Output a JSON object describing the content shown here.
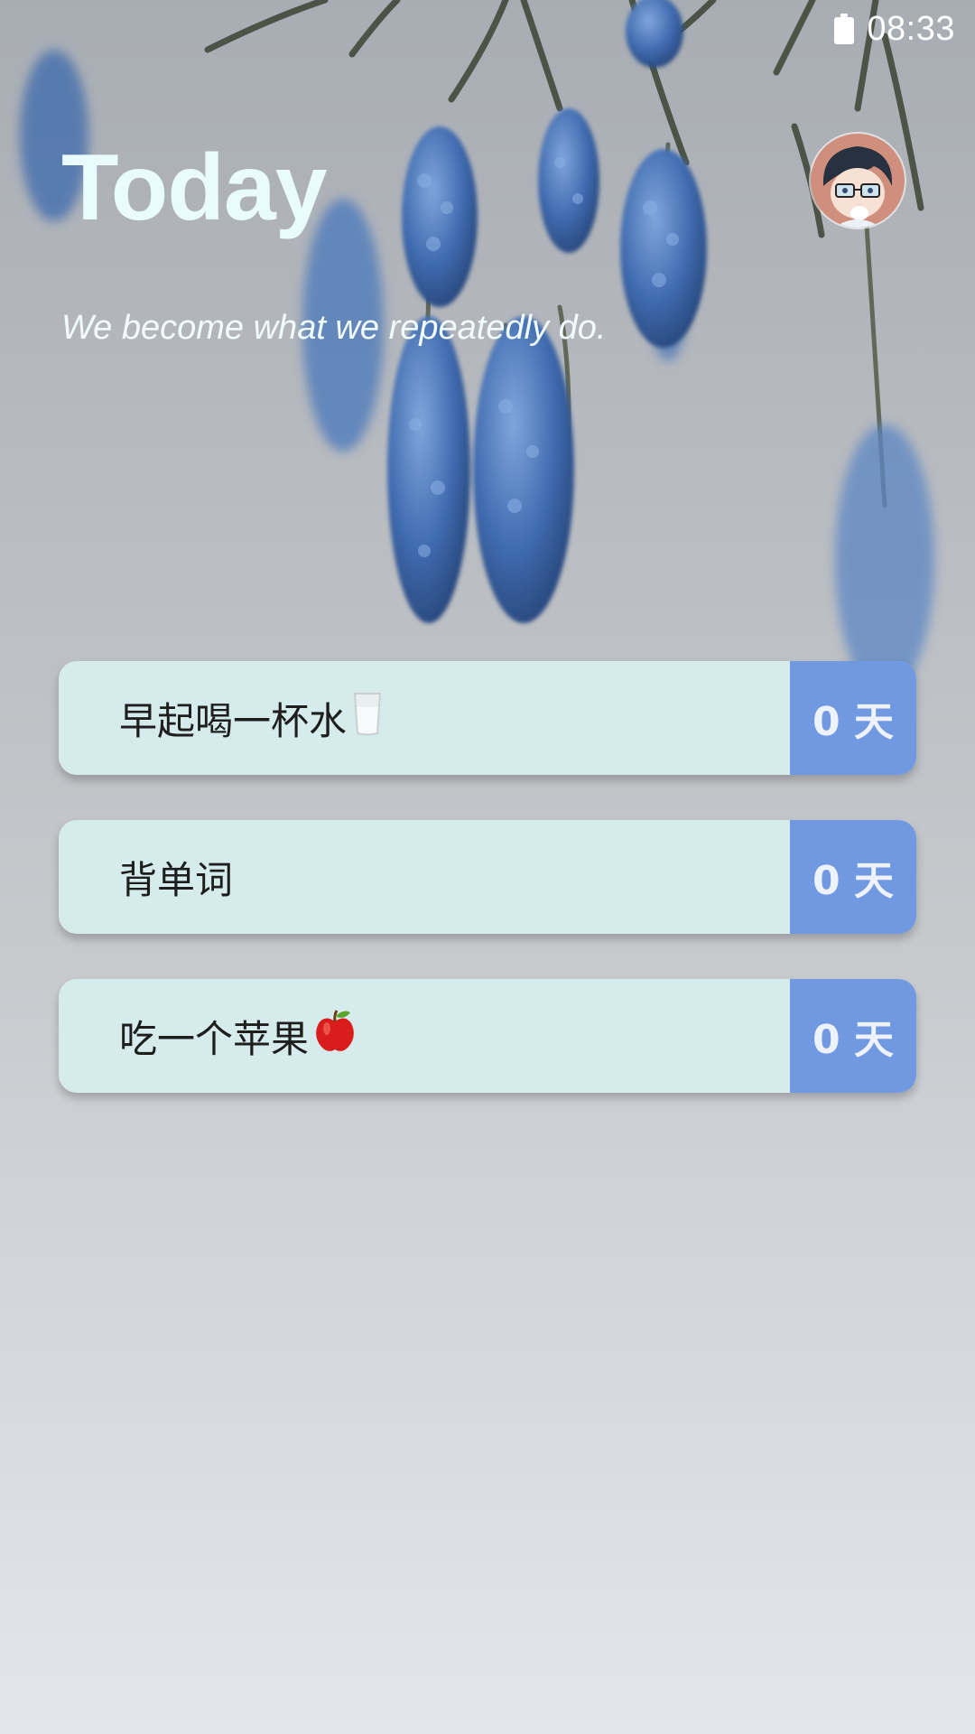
{
  "status_bar": {
    "time": "08:33",
    "battery_icon": "battery-full-icon"
  },
  "header": {
    "title": "Today",
    "quote": "We become what we repeatedly do.",
    "avatar_icon": "avatar-icon"
  },
  "habits": [
    {
      "name": "早起喝一杯水",
      "emoji_icon": "glass-of-water-icon",
      "count_label": "0 天"
    },
    {
      "name": "背单词",
      "emoji_icon": "",
      "count_label": "0 天"
    },
    {
      "name": "吃一个苹果",
      "emoji_icon": "red-apple-icon",
      "count_label": "0 天"
    }
  ],
  "colors": {
    "title": "#e9fbfd",
    "card_background": "#d6ecec",
    "count_background": "#7199e1",
    "count_text": "#eef3fb"
  }
}
